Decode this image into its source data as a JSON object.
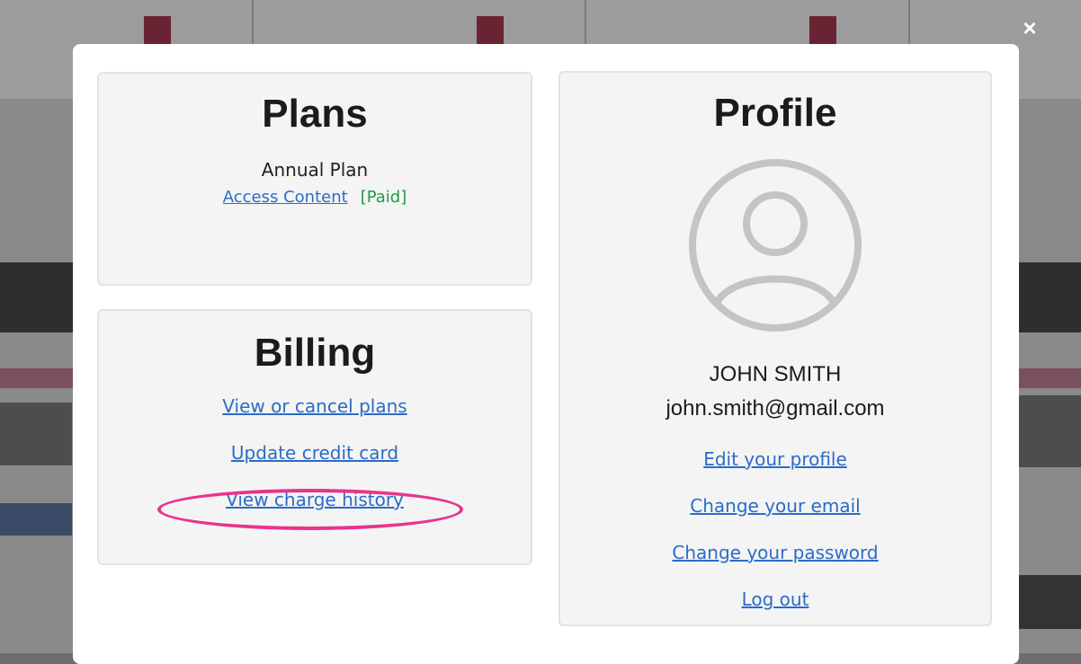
{
  "close_label": "×",
  "plans": {
    "title": "Plans",
    "plan_name": "Annual Plan",
    "access_link": "Access Content",
    "status": "[Paid]"
  },
  "billing": {
    "title": "Billing",
    "links": [
      "View or cancel plans",
      "Update credit card",
      "View charge history"
    ]
  },
  "profile": {
    "title": "Profile",
    "name": "JOHN SMITH",
    "email": "john.smith@gmail.com",
    "links": [
      "Edit your profile",
      "Change your email",
      "Change your password",
      "Log out"
    ]
  },
  "colors": {
    "link": "#2b6cc7",
    "paid": "#1f9a4a",
    "highlight": "#e8348c"
  }
}
